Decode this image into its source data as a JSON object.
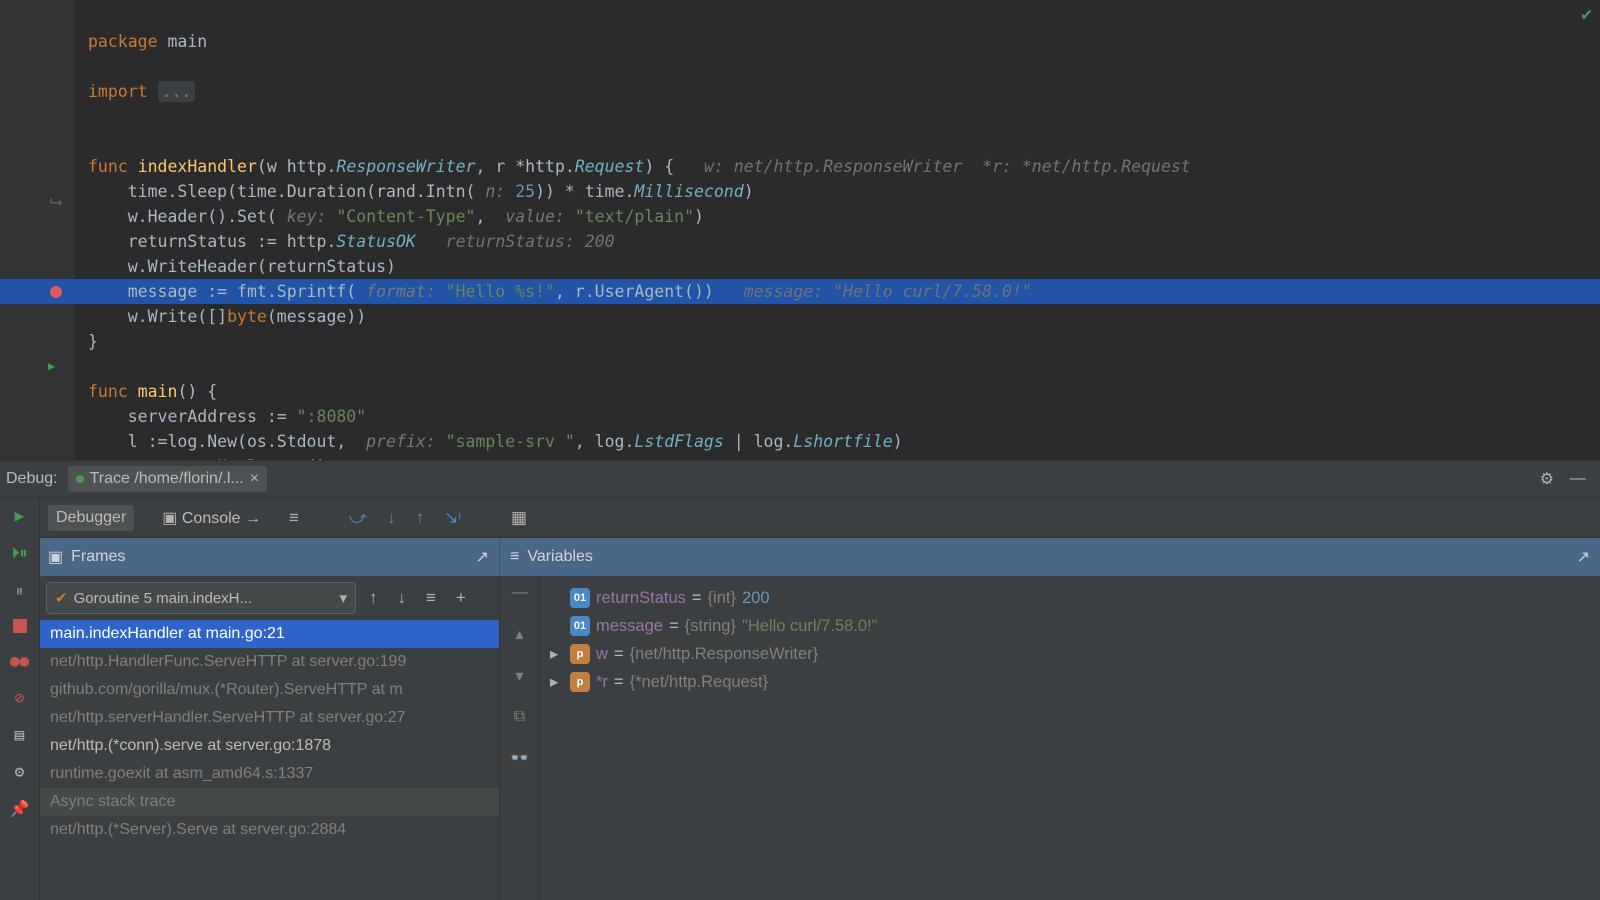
{
  "editor": {
    "package_kw": "package",
    "package_name": "main",
    "import_kw": "import",
    "import_fold": "...",
    "func_kw1": "func",
    "func_name1": "indexHandler",
    "sig1_a": "(w http.",
    "sig1_rw": "ResponseWriter",
    "sig1_b": ", r *http.",
    "sig1_req": "Request",
    "sig1_c": ") {",
    "hint1": "w: net/http.ResponseWriter  *r: *net/http.Request",
    "l2_a": "time.Sleep(time.Duration(rand.Intn(",
    "l2_hint": " n: ",
    "l2_num": "25",
    "l2_b": ")) * time.",
    "l2_ms": "Millisecond",
    "l2_c": ")",
    "l3_a": "w.Header().Set(",
    "l3_h1": " key: ",
    "l3_s1": "\"Content-Type\"",
    "l3_comma": ", ",
    "l3_h2": " value: ",
    "l3_s2": "\"text/plain\"",
    "l3_end": ")",
    "l4_a": "returnStatus := http.",
    "l4_const": "StatusOK",
    "l4_hint": "returnStatus: 200",
    "l5": "w.WriteHeader(returnStatus)",
    "l6_a": "message := fmt.Sprintf(",
    "l6_h": " format: ",
    "l6_s": "\"Hello %s!\"",
    "l6_b": ", r.UserAgent())",
    "l6_hint": "message: \"Hello curl/7.58.0!\"",
    "l7_a": "w.Write([]",
    "l7_byte": "byte",
    "l7_b": "(message))",
    "l8": "}",
    "func_kw2": "func",
    "func_name2": "main",
    "sig2": "() {",
    "m1_a": "serverAddress := ",
    "m1_s": "\":8080\"",
    "m2_a": "l :=log.New(os.Stdout, ",
    "m2_h": " prefix: ",
    "m2_s": "\"sample-srv \"",
    "m2_b": ", log.",
    "m2_c1": "LstdFlags",
    "m2_pipe": " | log.",
    "m2_c2": "Lshortfile",
    "m2_end": ")",
    "m3": "m := mux.NewRouter()"
  },
  "debug": {
    "label": "Debug:",
    "tab_name": "Trace /home/florin/.l...",
    "debugger_tab": "Debugger",
    "console_tab": "Console",
    "frames_label": "Frames",
    "variables_label": "Variables",
    "goroutine_label": "Goroutine 5 main.indexH...",
    "frames": [
      "main.indexHandler at main.go:21",
      "net/http.HandlerFunc.ServeHTTP at server.go:199",
      "github.com/gorilla/mux.(*Router).ServeHTTP at m",
      "net/http.serverHandler.ServeHTTP at server.go:27",
      "net/http.(*conn).serve at server.go:1878",
      "runtime.goexit at asm_amd64.s:1337"
    ],
    "async_label": "Async stack trace",
    "async_frame": "net/http.(*Server).Serve at server.go:2884"
  },
  "variables": {
    "v1": {
      "name": "returnStatus",
      "type": "{int}",
      "val": "200"
    },
    "v2": {
      "name": "message",
      "type": "{string}",
      "val": "\"Hello curl/7.58.0!\""
    },
    "v3": {
      "name": "w",
      "type": "{net/http.ResponseWriter}"
    },
    "v4": {
      "name": "*r",
      "type": "{*net/http.Request}"
    }
  }
}
